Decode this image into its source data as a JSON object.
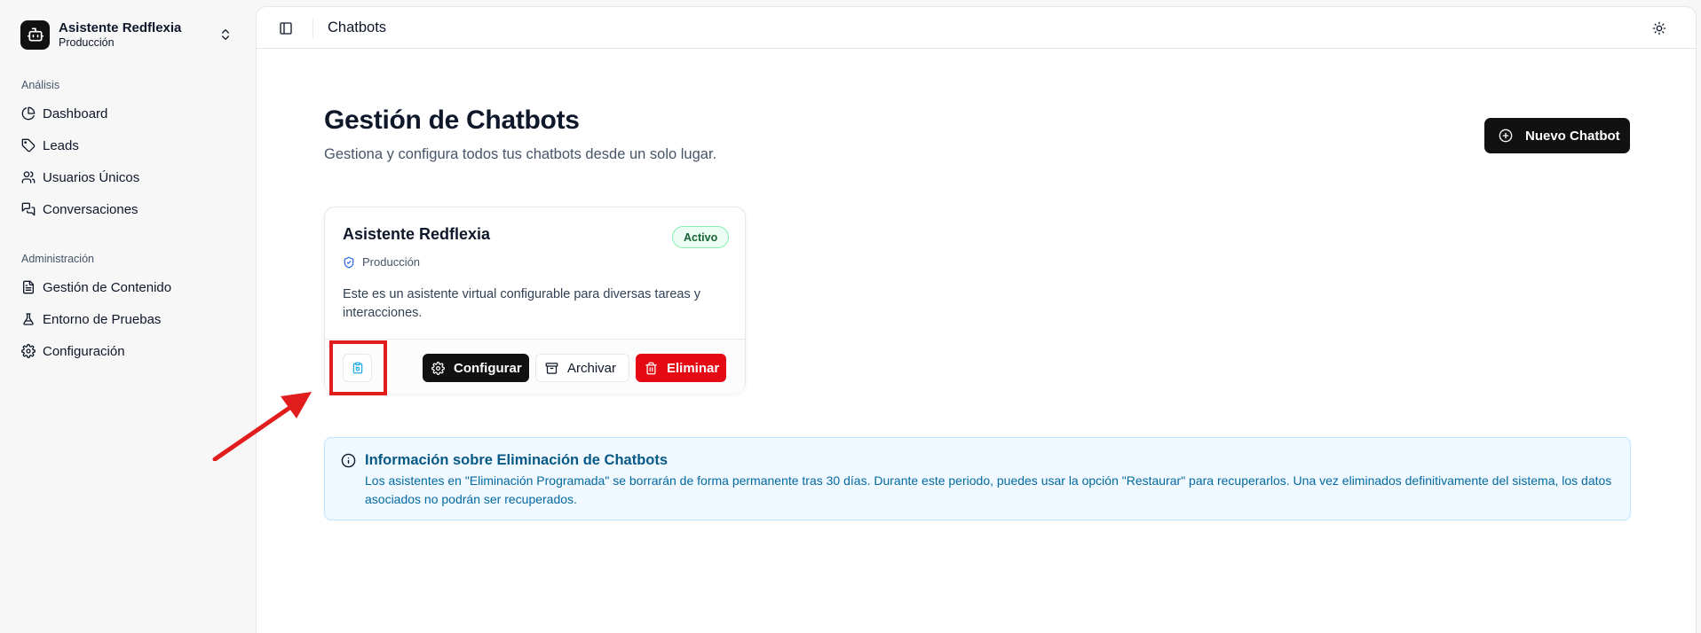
{
  "sidebar": {
    "switcher": {
      "name": "Asistente Redflexia",
      "env": "Producción",
      "logo_icon": "bot-icon",
      "chevron_icon": "chevrons-up-down-icon"
    },
    "groups": [
      {
        "label": "Análisis",
        "items": [
          {
            "label": "Dashboard",
            "icon": "pie-chart-icon"
          },
          {
            "label": "Leads",
            "icon": "tag-icon"
          },
          {
            "label": "Usuarios Únicos",
            "icon": "users-icon"
          },
          {
            "label": "Conversaciones",
            "icon": "messages-icon"
          }
        ]
      },
      {
        "label": "Administración",
        "items": [
          {
            "label": "Gestión de Contenido",
            "icon": "file-text-icon"
          },
          {
            "label": "Entorno de Pruebas",
            "icon": "flask-icon"
          },
          {
            "label": "Configuración",
            "icon": "gear-icon"
          }
        ]
      }
    ]
  },
  "topbar": {
    "title": "Chatbots",
    "sidebar_toggle_icon": "panel-left-icon",
    "theme_icon": "sun-icon"
  },
  "main": {
    "title": "Gestión de Chatbots",
    "subtitle": "Gestiona y configura todos tus chatbots desde un solo lugar.",
    "new_button": "Nuevo Chatbot"
  },
  "card": {
    "title": "Asistente Redflexia",
    "status": "Activo",
    "env": "Producción",
    "description": "Este es un asistente virtual configurable para diversas tareas y interacciones.",
    "buttons": {
      "configure": "Configurar",
      "archive": "Archivar",
      "delete": "Eliminar"
    }
  },
  "info": {
    "title": "Información sobre Eliminación de Chatbots",
    "text": "Los asistentes en \"Eliminación Programada\" se borrarán de forma permanente tras 30 días. Durante este periodo, puedes usar la opción \"Restaurar\" para recuperarlos. Una vez eliminados definitivamente del sistema, los datos asociados no podrán ser recuperados."
  },
  "colors": {
    "primary": "#111111",
    "danger": "#e50914",
    "success_bg": "#ecfdf5",
    "info_bg": "#f0f9ff",
    "info_text": "#0369a1",
    "annotation": "#e11d1d"
  }
}
